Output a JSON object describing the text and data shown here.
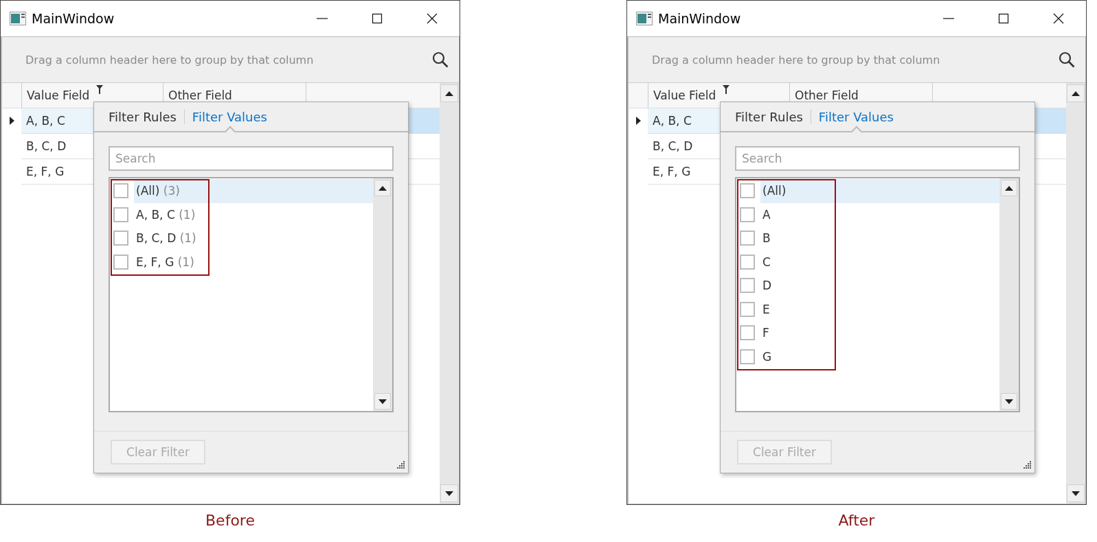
{
  "panels": [
    {
      "window": {
        "title": "MainWindow"
      },
      "group_hint": "Drag a column header here to group by that column",
      "columns": [
        {
          "label": "Value Field",
          "filtered": true
        },
        {
          "label": "Other Field",
          "filtered": false
        }
      ],
      "rows": [
        {
          "value": "A, B, C",
          "selected": true,
          "current": true
        },
        {
          "value": "B, C, D",
          "selected": false,
          "current": false
        },
        {
          "value": "E, F, G",
          "selected": false,
          "current": false
        }
      ],
      "filter_popup": {
        "tabs": [
          {
            "label": "Filter Rules",
            "selected": false
          },
          {
            "label": "Filter Values",
            "selected": true
          }
        ],
        "search": {
          "placeholder": "Search"
        },
        "items": [
          {
            "label": "(All)",
            "count": "(3)",
            "checked": false,
            "selected": true
          },
          {
            "label": "A, B, C",
            "count": "(1)",
            "checked": false,
            "selected": false
          },
          {
            "label": "B, C, D",
            "count": "(1)",
            "checked": false,
            "selected": false
          },
          {
            "label": "E, F, G",
            "count": "(1)",
            "checked": false,
            "selected": false
          }
        ],
        "clear_button": {
          "label": "Clear Filter",
          "disabled": true
        }
      },
      "caption": "Before"
    },
    {
      "window": {
        "title": "MainWindow"
      },
      "group_hint": "Drag a column header here to group by that column",
      "columns": [
        {
          "label": "Value Field",
          "filtered": true
        },
        {
          "label": "Other Field",
          "filtered": false
        }
      ],
      "rows": [
        {
          "value": "A, B, C",
          "selected": true,
          "current": true
        },
        {
          "value": "B, C, D",
          "selected": false,
          "current": false
        },
        {
          "value": "E, F, G",
          "selected": false,
          "current": false
        }
      ],
      "filter_popup": {
        "tabs": [
          {
            "label": "Filter Rules",
            "selected": false
          },
          {
            "label": "Filter Values",
            "selected": true
          }
        ],
        "search": {
          "placeholder": "Search"
        },
        "items": [
          {
            "label": "(All)",
            "checked": false,
            "selected": true
          },
          {
            "label": "A",
            "checked": false,
            "selected": false
          },
          {
            "label": "B",
            "checked": false,
            "selected": false
          },
          {
            "label": "C",
            "checked": false,
            "selected": false
          },
          {
            "label": "D",
            "checked": false,
            "selected": false
          },
          {
            "label": "E",
            "checked": false,
            "selected": false
          },
          {
            "label": "F",
            "checked": false,
            "selected": false
          },
          {
            "label": "G",
            "checked": false,
            "selected": false
          }
        ],
        "clear_button": {
          "label": "Clear Filter",
          "disabled": true
        }
      },
      "caption": "After"
    }
  ]
}
